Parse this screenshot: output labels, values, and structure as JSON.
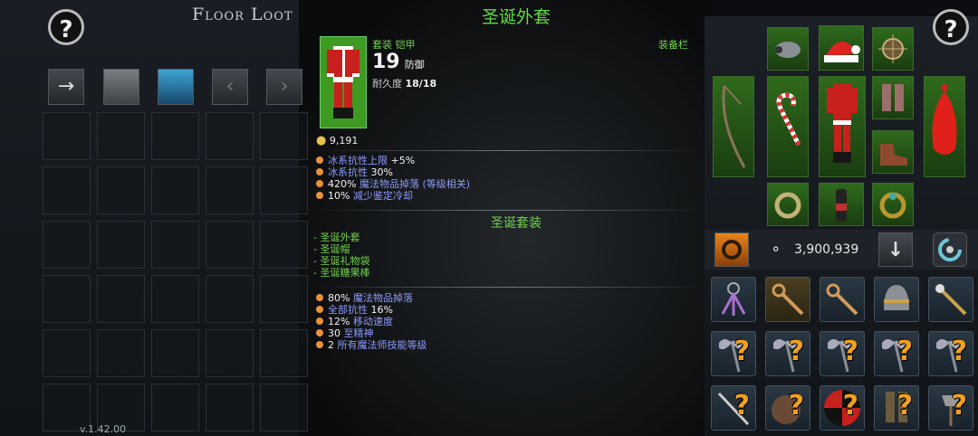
{
  "floor_loot": {
    "title": "Floor Loot",
    "help": "?",
    "tabs": [
      "→",
      "",
      "",
      "‹",
      "›"
    ],
    "version": "v.1.42.00"
  },
  "tooltip": {
    "item_name": "圣诞外套",
    "slot_label": "装备栏",
    "type": "套装 铠甲",
    "defense_value": "19",
    "defense_label": "防御",
    "durability_label": "耐久度",
    "durability_value": "18/18",
    "price": "9,191",
    "stats": [
      {
        "pre": "冰系抗性上限 ",
        "val": "+5%",
        "post": ""
      },
      {
        "pre": "冰系抗性 ",
        "val": "30%",
        "post": ""
      },
      {
        "pre": "",
        "val": "420%",
        "post": " 魔法物品掉落 (等级相关)"
      },
      {
        "pre": "",
        "val": "10%",
        "post": " 减少鉴定冷却"
      }
    ],
    "set_title": "圣诞套装",
    "set_items": [
      "- 圣诞外套",
      "- 圣诞帽",
      "- 圣诞礼物袋",
      "- 圣诞糖果棒"
    ],
    "set_bonuses": [
      {
        "pre": "",
        "val": "80%",
        "post": " 魔法物品掉落"
      },
      {
        "pre": "全部抗性 ",
        "val": "16%",
        "post": ""
      },
      {
        "pre": "",
        "val": "12%",
        "post": " 移动速度"
      },
      {
        "pre": "",
        "val": "30",
        "post": " 至精神"
      },
      {
        "pre": "",
        "val": "2",
        "post": " 所有魔法师技能等级"
      }
    ]
  },
  "equipment": {
    "help": "?",
    "gold": "3,900,939",
    "sort_icon": "↓"
  },
  "inventory_unknown": "?",
  "colors": {
    "green": "#6fd24a",
    "stat_value": "#f2f2f2",
    "bullet": "#e8923a",
    "gold": "#e6c34a"
  }
}
